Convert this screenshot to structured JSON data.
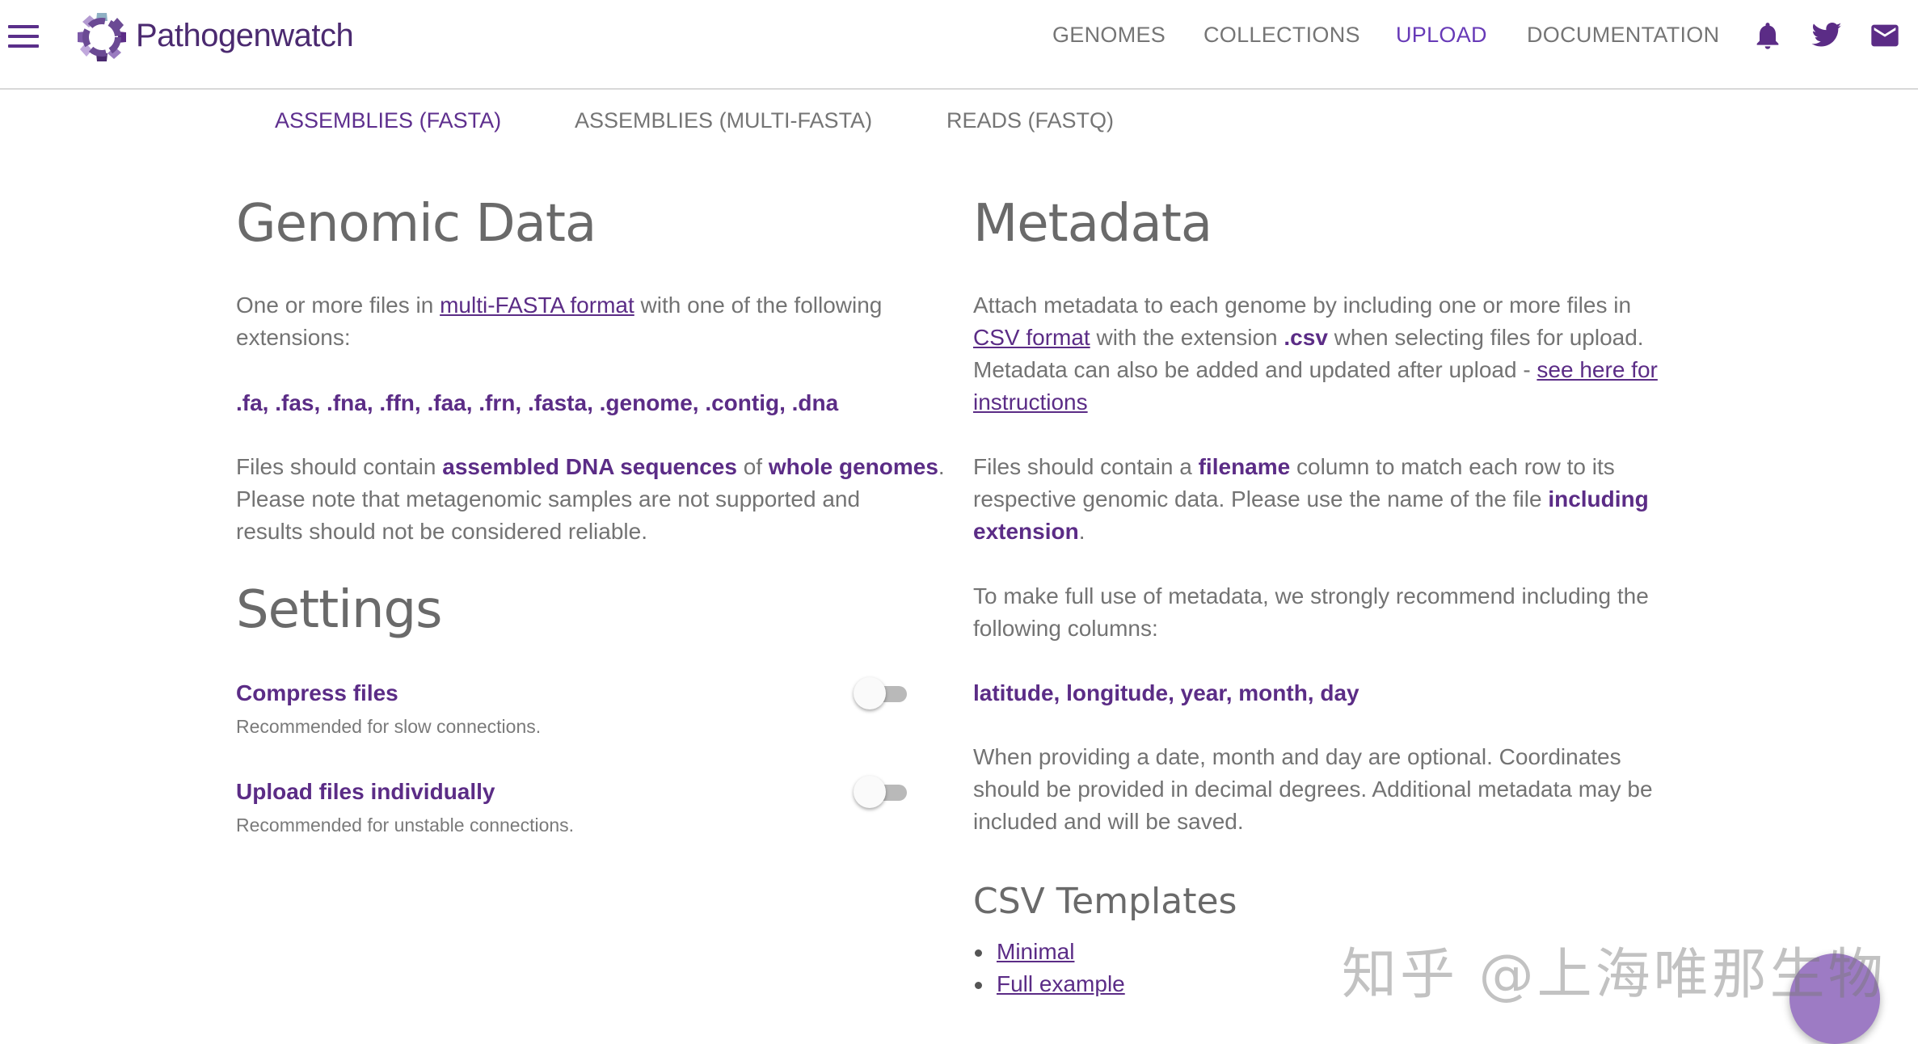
{
  "brand": {
    "name_part1": "Pathogen",
    "name_part2": "watch",
    "accent": "#673ab7",
    "logo_icon": "gear-logo-icon"
  },
  "nav": {
    "items": [
      "GENOMES",
      "COLLECTIONS",
      "UPLOAD",
      "DOCUMENTATION"
    ],
    "active": "UPLOAD",
    "icons": [
      "bell-icon",
      "twitter-icon",
      "mail-icon"
    ]
  },
  "tabs": {
    "items": [
      "ASSEMBLIES (FASTA)",
      "ASSEMBLIES (MULTI-FASTA)",
      "READS (FASTQ)"
    ],
    "active": "ASSEMBLIES (FASTA)"
  },
  "genomic": {
    "title": "Genomic Data",
    "p1_pre": "One or more files in ",
    "p1_link": "multi-FASTA format",
    "p1_post1": " with one of the following",
    "p1_post2": "extensions:",
    "extensions": ".fa, .fas, .fna, .ffn, .faa, .frn, .fasta, .genome, .contig, .dna",
    "p2_pre": "Files should contain ",
    "p2_hl1": "assembled DNA sequences",
    "p2_mid": " of ",
    "p2_hl2": "whole genomes",
    "p2_end": ".",
    "p2_line2": "Please note that metagenomic samples are not supported and",
    "p2_line3": "results should not be considered reliable."
  },
  "settings": {
    "title": "Settings",
    "items": [
      {
        "label": "Compress files",
        "desc": "Recommended for slow connections.",
        "enabled": false
      },
      {
        "label": "Upload files individually",
        "desc": "Recommended for unstable connections.",
        "enabled": false
      }
    ]
  },
  "metadata": {
    "title": "Metadata",
    "p1_l1": "Attach metadata to each genome by including one or more files in",
    "p1_link": "CSV format",
    "p1_l2_mid": " with the extension ",
    "p1_l2_hl": ".csv",
    "p1_l2_end": " when selecting files for upload.",
    "p1_l3_pre": "Metadata can also be added and updated after upload - ",
    "p1_l3_link": "see here for",
    "p1_l4_link": "instructions",
    "p2_l1_pre": "Files should contain a ",
    "p2_l1_hl": "filename",
    "p2_l1_end": " column to match each row to its",
    "p2_l2_pre": "respective genomic data. Please use the name of the file ",
    "p2_l2_hl": "including",
    "p2_l3_hl": "extension",
    "p2_l3_end": ".",
    "p3_l1": "To make full use of metadata, we strongly recommend including the",
    "p3_l2": "following columns:",
    "columns": "latitude, longitude, year, month, day",
    "p4_l1": "When providing a date, month and day are optional. Coordinates",
    "p4_l2": "should be provided in decimal degrees. Additional metadata may be",
    "p4_l3": "included and will be saved."
  },
  "csv": {
    "title": "CSV Templates",
    "links": [
      "Minimal",
      "Full example"
    ]
  },
  "watermark": "知乎 @上海唯那生物"
}
